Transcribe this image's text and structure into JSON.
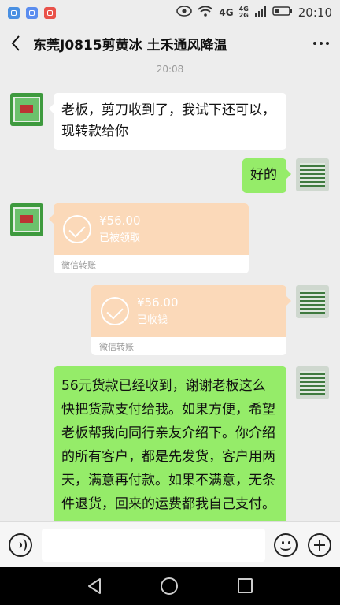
{
  "status_bar": {
    "network_1": "4G",
    "network_2a": "4G",
    "network_2b": "2G",
    "time": "20:10"
  },
  "header": {
    "title": "东莞J0815剪黄冰  土禾通风降温"
  },
  "timestamp": "20:08",
  "messages": [
    {
      "side": "left",
      "type": "text",
      "text": "老板，剪刀收到了，我试下还可以，现转款给你"
    },
    {
      "side": "right",
      "type": "text",
      "text": "好的"
    },
    {
      "side": "left",
      "type": "transfer",
      "amount": "¥56.00",
      "status": "已被领取",
      "footer": "微信转账"
    },
    {
      "side": "right",
      "type": "transfer",
      "amount": "¥56.00",
      "status": "已收钱",
      "footer": "微信转账"
    },
    {
      "side": "right",
      "type": "text",
      "text": "56元货款已经收到，谢谢老板这么快把货款支付给我。如果方便，希望老板帮我向同行亲友介绍下。你介绍的所有客户，都是先发货，客户用两天，满意再付款。如果不满意，无条件退货，回来的运费都我自己支付。"
    }
  ],
  "input_bar": {
    "placeholder": ""
  },
  "colors": {
    "background": "#ededed",
    "self_bubble": "#95ec69",
    "other_bubble": "#ffffff",
    "transfer_card": "#fbd9b9"
  }
}
